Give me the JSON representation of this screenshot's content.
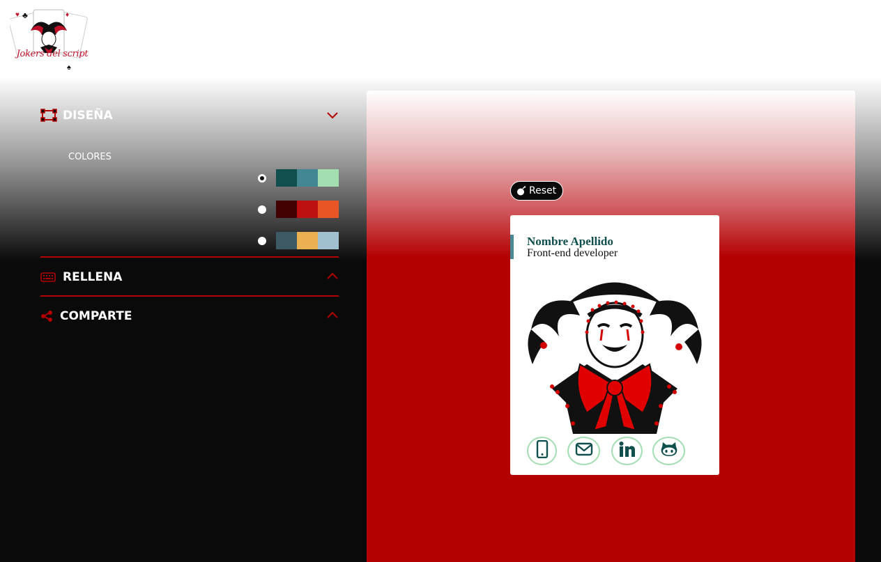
{
  "logo": {
    "text": "Jokers del script"
  },
  "panel": {
    "design": {
      "label": "DISEÑA"
    },
    "colors": {
      "label": "COLORES",
      "palettes": [
        {
          "checked": true,
          "swatches": [
            "#114e4e",
            "#438792",
            "#a2deaf"
          ]
        },
        {
          "checked": false,
          "swatches": [
            "#420101",
            "#bd1010",
            "#e95626"
          ]
        },
        {
          "checked": false,
          "swatches": [
            "#3e5b65",
            "#eab052",
            "#a0c0cf"
          ]
        }
      ]
    },
    "fill": {
      "label": "RELLENA"
    },
    "share": {
      "label": "COMPARTE"
    }
  },
  "preview": {
    "reset_label": "Reset",
    "card": {
      "name": "Nombre Apellido",
      "job": "Front-end developer",
      "social": [
        "phone-icon",
        "mail-icon",
        "linkedin-icon",
        "github-icon"
      ]
    }
  },
  "colors": {
    "accent": "#b30000",
    "dark": "#0a0a0a",
    "name_color": "#114e4e",
    "social_border": "#a2deb2"
  }
}
